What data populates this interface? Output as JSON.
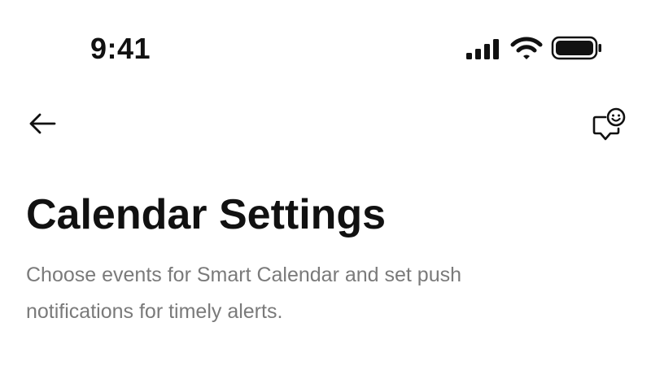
{
  "status_bar": {
    "time": "9:41"
  },
  "icons": {
    "signal": "cellular-signal-icon",
    "wifi": "wifi-icon",
    "battery": "battery-icon",
    "back": "arrow-left-icon",
    "feedback": "smiley-chat-icon"
  },
  "colors": {
    "text_primary": "#111111",
    "text_secondary": "#7a7a7a",
    "background": "#ffffff"
  },
  "page": {
    "title": "Calendar Settings",
    "description": "Choose events for Smart Calendar and set push notifications for timely alerts."
  }
}
